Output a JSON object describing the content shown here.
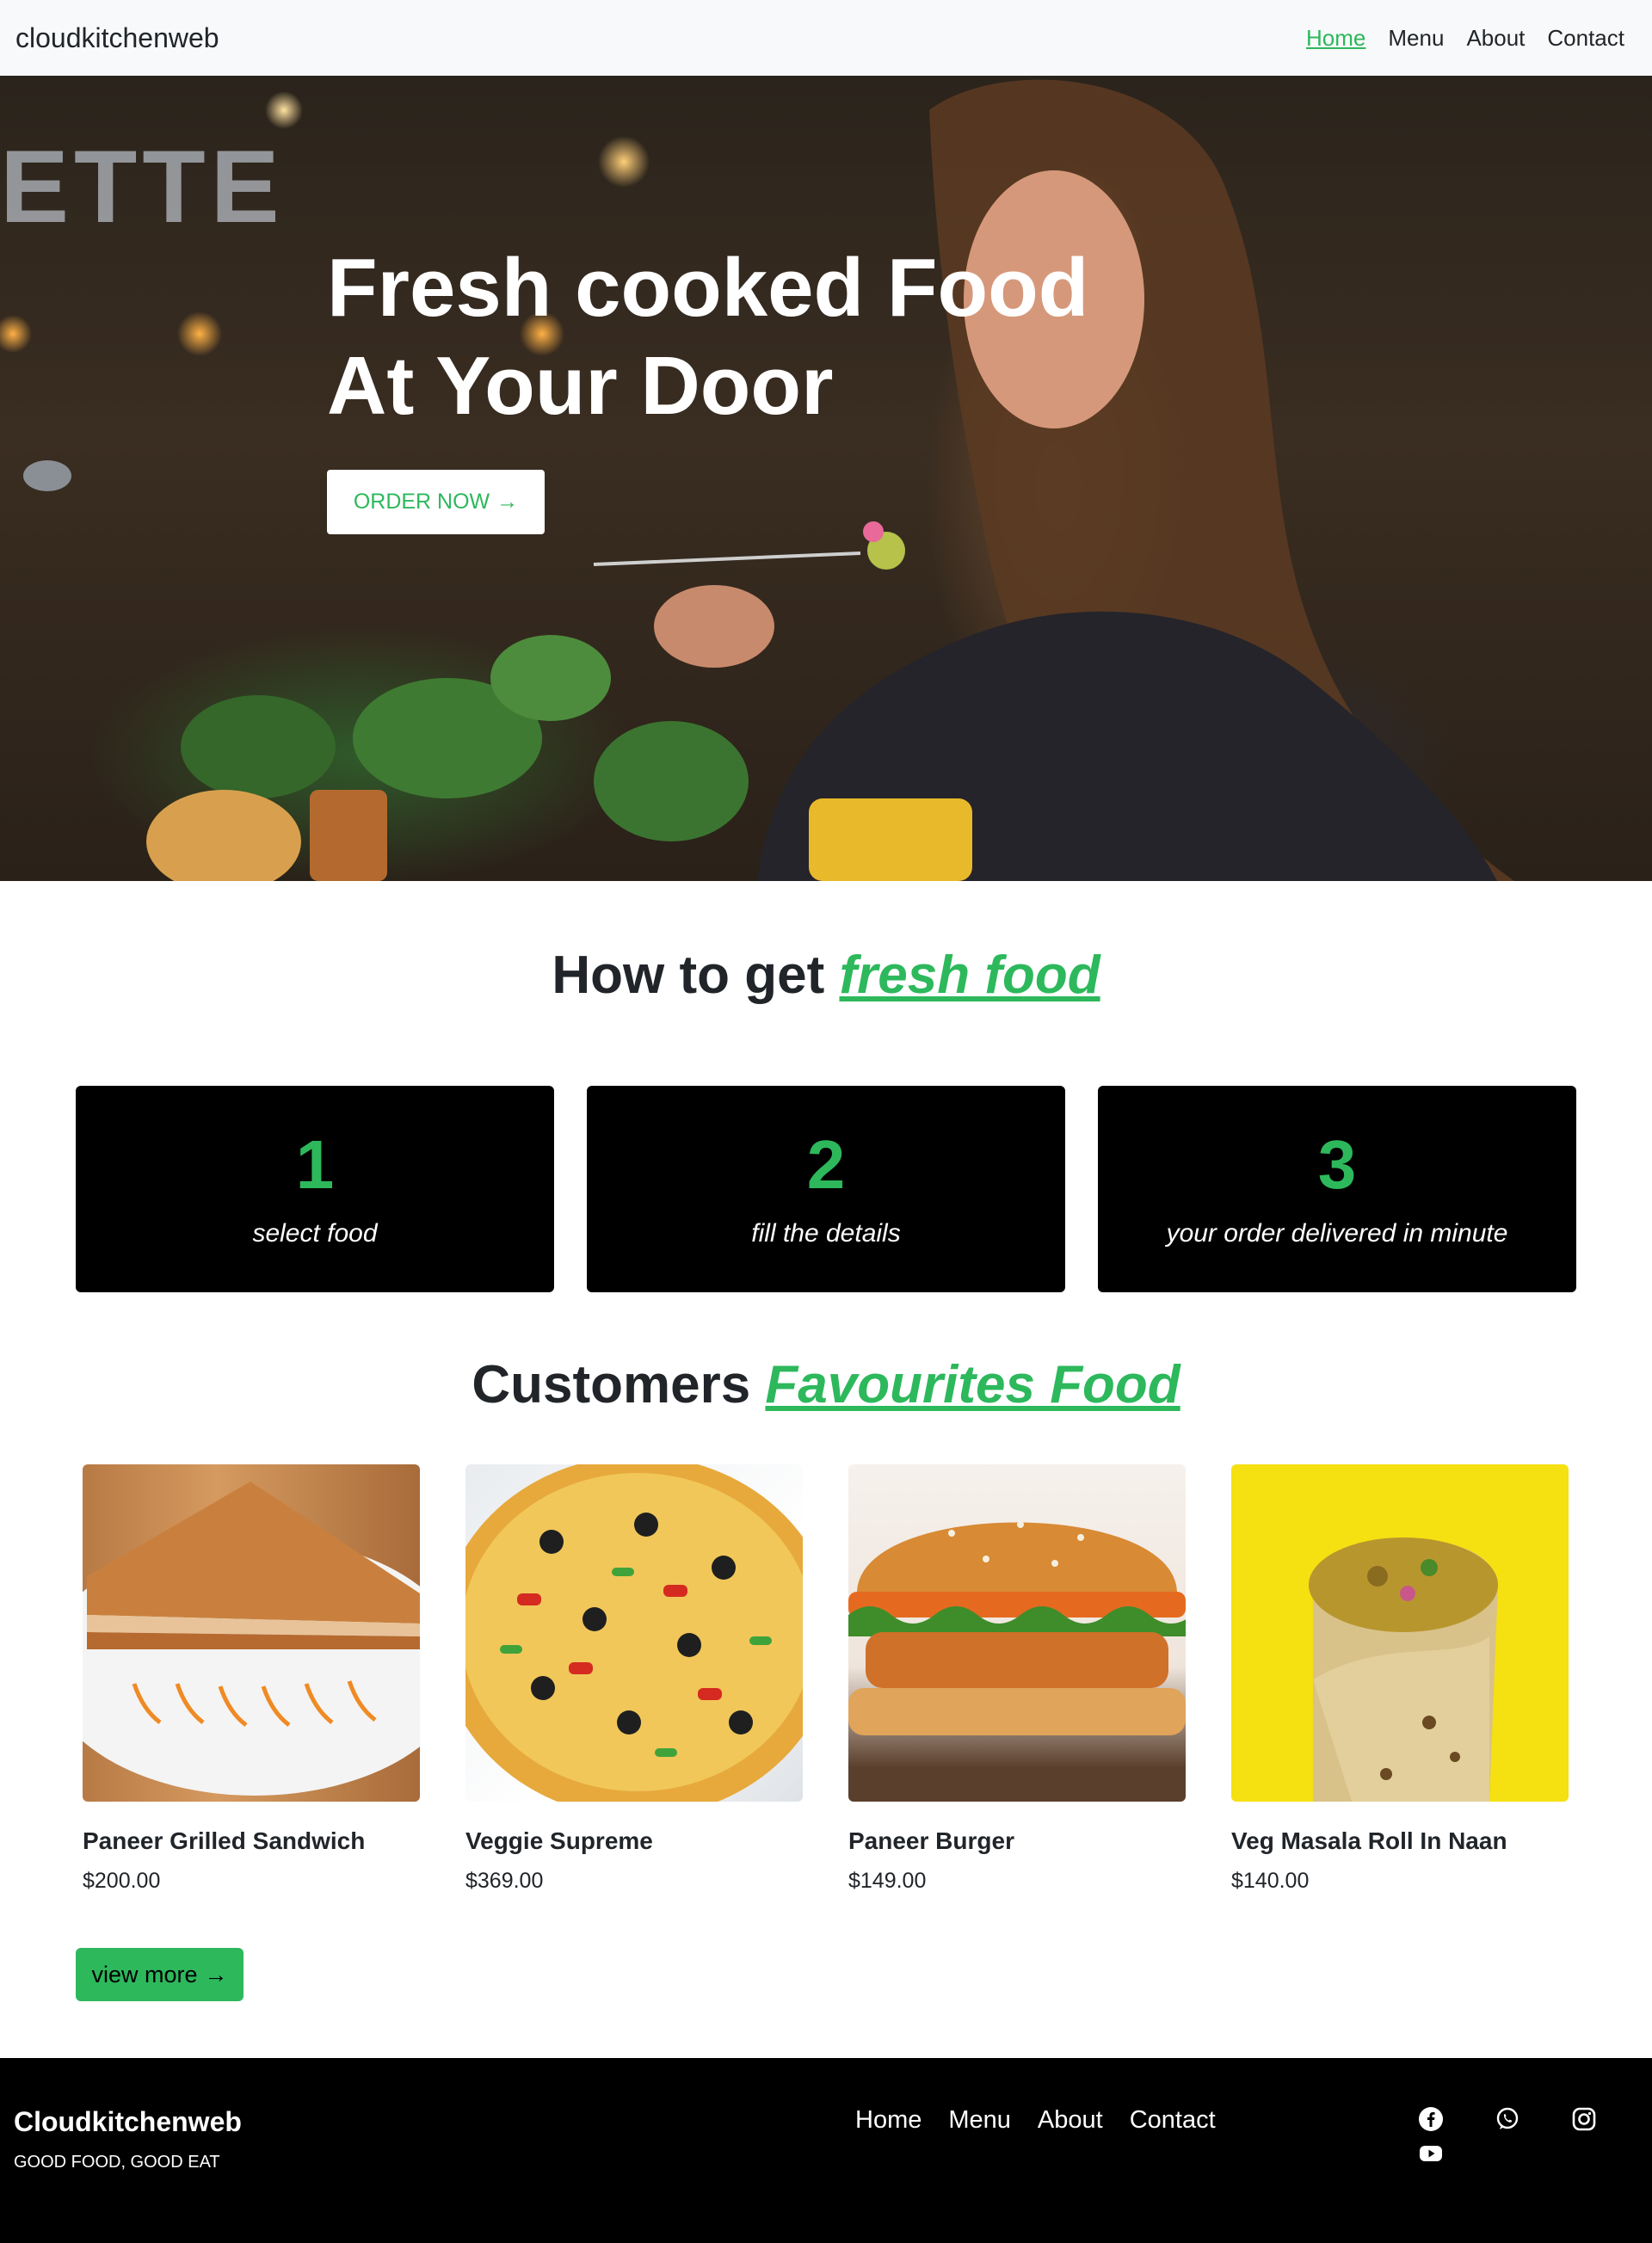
{
  "navbar": {
    "brand": "cloudkitchenweb",
    "links": [
      "Home",
      "Menu",
      "About",
      "Contact"
    ],
    "active": "Home"
  },
  "hero": {
    "title": "Fresh cooked Food\nAt Your Door",
    "cta_label": "ORDER NOW",
    "cta_icon": "arrow-right-icon",
    "sign_text": "ETTE"
  },
  "how_to": {
    "heading_plain": "How to get",
    "heading_accent": "fresh food",
    "steps": [
      {
        "number": "1",
        "text": "select food"
      },
      {
        "number": "2",
        "text": "fill the details"
      },
      {
        "number": "3",
        "text": "your order delivered in minute"
      }
    ]
  },
  "favourites": {
    "heading_plain": "Customers",
    "heading_accent": "Favourites Food",
    "items": [
      {
        "name": "Paneer Grilled Sandwich",
        "price": "$200.00",
        "image": "sandwich-image"
      },
      {
        "name": "Veggie Supreme",
        "price": "$369.00",
        "image": "pizza-image"
      },
      {
        "name": "Paneer Burger",
        "price": "$149.00",
        "image": "burger-image"
      },
      {
        "name": "Veg Masala Roll In Naan",
        "price": "$140.00",
        "image": "roll-image"
      }
    ],
    "view_more_label": "view more"
  },
  "footer": {
    "brand": "Cloudkitchenweb",
    "tagline": "GOOD FOOD, GOOD EAT",
    "links": [
      "Home",
      "Menu",
      "About",
      "Contact"
    ],
    "socials": [
      "facebook-icon",
      "whatsapp-icon",
      "instagram-icon",
      "youtube-icon"
    ]
  },
  "colors": {
    "accent": "#2db85c",
    "navbar_bg": "#f8f9fa",
    "card_bg": "#000000",
    "footer_bg": "#000000"
  }
}
